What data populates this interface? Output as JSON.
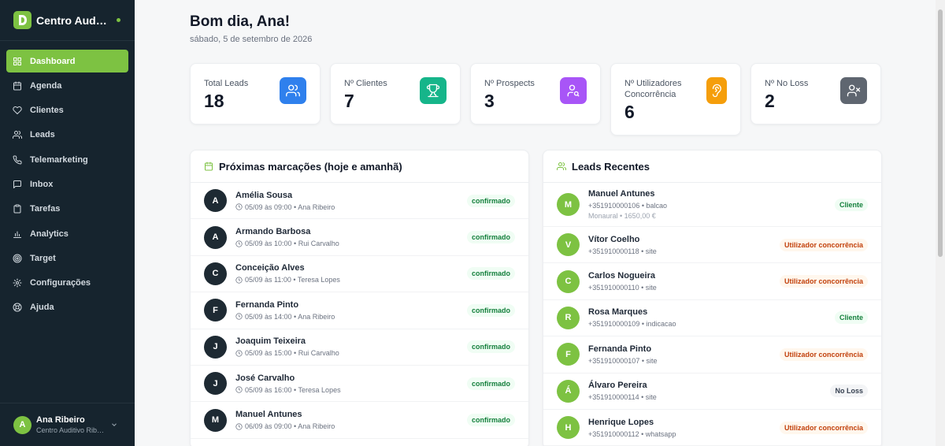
{
  "brand": {
    "name": "Centro Auditivo Ribeiro"
  },
  "nav": [
    {
      "label": "Dashboard",
      "icon": "grid-icon"
    },
    {
      "label": "Agenda",
      "icon": "calendar-icon"
    },
    {
      "label": "Clientes",
      "icon": "heart-icon"
    },
    {
      "label": "Leads",
      "icon": "users-icon"
    },
    {
      "label": "Telemarketing",
      "icon": "phone-icon"
    },
    {
      "label": "Inbox",
      "icon": "inbox-icon"
    },
    {
      "label": "Tarefas",
      "icon": "clipboard-icon"
    },
    {
      "label": "Analytics",
      "icon": "bar-chart-icon"
    },
    {
      "label": "Target",
      "icon": "target-icon"
    },
    {
      "label": "Configurações",
      "icon": "gear-icon"
    },
    {
      "label": "Ajuda",
      "icon": "help-icon"
    }
  ],
  "user": {
    "initial": "A",
    "name": "Ana Ribeiro",
    "org": "Centro Auditivo Ribeiro"
  },
  "header": {
    "greeting": "Bom dia, Ana!",
    "date": "sábado, 5 de setembro de 2026"
  },
  "stats": [
    {
      "label": "Total Leads",
      "value": "18",
      "color": "#2f80ed",
      "icon": "users-icon"
    },
    {
      "label": "Nº Clientes",
      "value": "7",
      "color": "#16b58a",
      "icon": "trophy-icon"
    },
    {
      "label": "Nº Prospects",
      "value": "3",
      "color": "#a855f7",
      "icon": "user-search-icon"
    },
    {
      "label": "Nº Utilizadores Concorrência",
      "value": "6",
      "color": "#f59e0b",
      "icon": "ear-icon"
    },
    {
      "label": "Nº No Loss",
      "value": "2",
      "color": "#5f6670",
      "icon": "user-x-icon"
    }
  ],
  "appointments": {
    "title": "Próximas marcações (hoje e amanhã)",
    "items": [
      {
        "initial": "A",
        "name": "Amélia Sousa",
        "when": "05/09 às 09:00 • Ana Ribeiro",
        "status": "confirmado"
      },
      {
        "initial": "A",
        "name": "Armando Barbosa",
        "when": "05/09 às 10:00 • Rui Carvalho",
        "status": "confirmado"
      },
      {
        "initial": "C",
        "name": "Conceição Alves",
        "when": "05/09 às 11:00 • Teresa Lopes",
        "status": "confirmado"
      },
      {
        "initial": "F",
        "name": "Fernanda Pinto",
        "when": "05/09 às 14:00 • Ana Ribeiro",
        "status": "confirmado"
      },
      {
        "initial": "J",
        "name": "Joaquim Teixeira",
        "when": "05/09 às 15:00 • Rui Carvalho",
        "status": "confirmado"
      },
      {
        "initial": "J",
        "name": "José Carvalho",
        "when": "05/09 às 16:00 • Teresa Lopes",
        "status": "confirmado"
      },
      {
        "initial": "M",
        "name": "Manuel Antunes",
        "when": "06/09 às 09:00 • Ana Ribeiro",
        "status": "confirmado"
      }
    ]
  },
  "leads": {
    "title": "Leads Recentes",
    "items": [
      {
        "initial": "M",
        "name": "Manuel Antunes",
        "sub": "+351910000106 • balcao",
        "sub2": "Monaural • 1650,00 €",
        "status": "Cliente"
      },
      {
        "initial": "V",
        "name": "Vítor Coelho",
        "sub": "+351910000118 • site",
        "status": "Utilizador concorrência"
      },
      {
        "initial": "C",
        "name": "Carlos Nogueira",
        "sub": "+351910000110 • site",
        "status": "Utilizador concorrência"
      },
      {
        "initial": "R",
        "name": "Rosa Marques",
        "sub": "+351910000109 • indicacao",
        "status": "Cliente"
      },
      {
        "initial": "F",
        "name": "Fernanda Pinto",
        "sub": "+351910000107 • site",
        "status": "Utilizador concorrência"
      },
      {
        "initial": "Á",
        "name": "Álvaro Pereira",
        "sub": "+351910000114 • site",
        "status": "No Loss"
      },
      {
        "initial": "H",
        "name": "Henrique Lopes",
        "sub": "+351910000112 • whatsapp",
        "status": "Utilizador concorrência"
      }
    ]
  },
  "colors": {
    "accent": "#7dc242",
    "sidebar": "#16242e",
    "appt_avatar": "#1e2a33"
  }
}
